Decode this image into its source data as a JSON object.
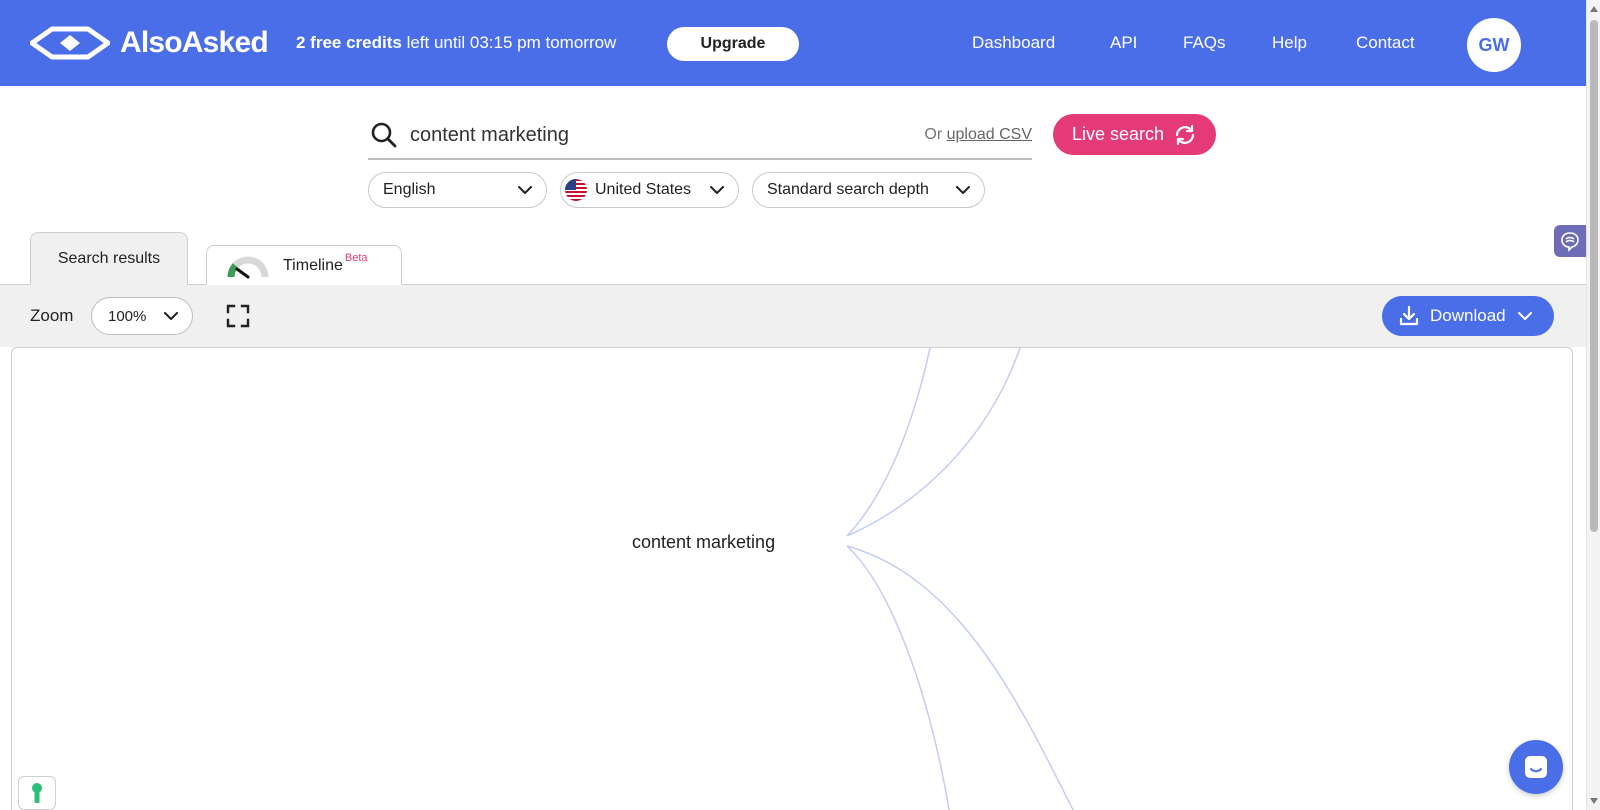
{
  "header": {
    "logo_text": "AlsoAsked",
    "credits_count": "2 free credits",
    "credits_rest": "left until 03:15 pm tomorrow",
    "upgrade_label": "Upgrade",
    "nav": [
      "Dashboard",
      "API",
      "FAQs",
      "Help",
      "Contact"
    ],
    "avatar_initials": "GW"
  },
  "search": {
    "query": "content marketing",
    "or_text": "Or",
    "upload_csv_label": "upload CSV",
    "live_search_label": "Live search",
    "language": "English",
    "region": "United States",
    "depth": "Standard search depth"
  },
  "tabs": {
    "search_results": "Search results",
    "timeline": "Timeline",
    "timeline_badge": "Beta"
  },
  "toolbar": {
    "zoom_label": "Zoom",
    "zoom_value": "100%",
    "download_label": "Download"
  },
  "canvas": {
    "root_node": "content marketing"
  },
  "colors": {
    "brand_blue": "#4a6ee8",
    "live_pink": "#e43a78",
    "curve": "#c4ccf6"
  }
}
